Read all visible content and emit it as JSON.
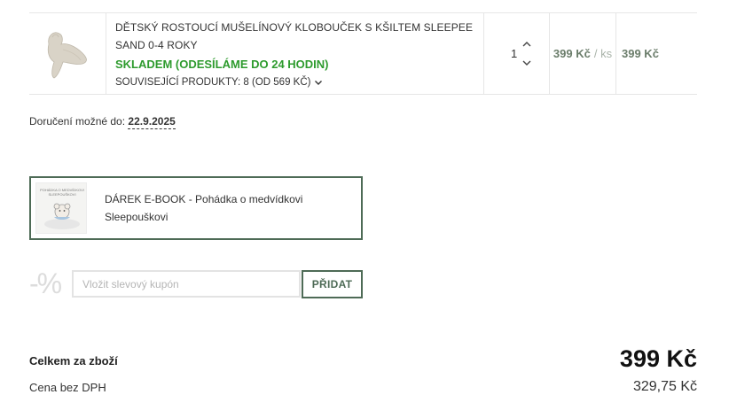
{
  "cart": {
    "item": {
      "name": "DĚTSKÝ ROSTOUCÍ MUŠELÍNOVÝ KLOBOUČEK S KŠILTEM SLEEPEE SAND 0-4 ROKY",
      "stock": "SKLADEM (ODESÍLÁME DO 24 HODIN)",
      "related": "SOUVISEJÍCÍ PRODUKTY: 8 (OD 569 KČ)",
      "quantity": "1",
      "unit_price": "399 Kč",
      "unit_suffix": "/ ks",
      "total_price": "399 Kč",
      "image_icon": "hat-product-image"
    }
  },
  "delivery": {
    "label": "Doručení možné do:",
    "date": "22.9.2025"
  },
  "gift": {
    "label": "DÁREK E-BOOK - Pohádka o medvídkovi Sleepouškovi",
    "thumb_title": "POHÁDKA O MEDVÍDKOVI SLEEPOUŠKOVI"
  },
  "coupon": {
    "percent_symbol": "-%",
    "placeholder": "Vložit slevový kupón",
    "button": "PŘIDAT"
  },
  "summary": {
    "total_label": "Celkem za zboží",
    "total_value": "399 Kč",
    "net_label": "Cena bez DPH",
    "net_value": "329,75 Kč"
  }
}
